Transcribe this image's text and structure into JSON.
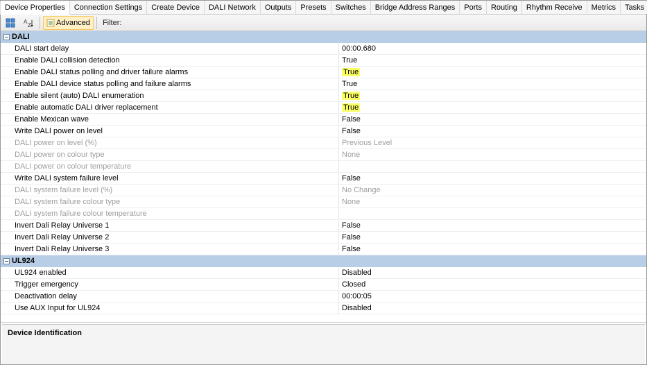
{
  "tabs": [
    "Device Properties",
    "Connection Settings",
    "Create Device",
    "DALI Network",
    "Outputs",
    "Presets",
    "Switches",
    "Bridge Address Ranges",
    "Ports",
    "Routing",
    "Rhythm Receive",
    "Metrics",
    "Tasks"
  ],
  "active_tab_index": 0,
  "toolbar": {
    "advanced_label": "Advanced",
    "filter_label": "Filter:"
  },
  "groups": [
    {
      "title": "DALI",
      "rows": [
        {
          "name": "DALI start delay",
          "value": "00:00.680",
          "disabled": false,
          "highlight": false
        },
        {
          "name": "Enable DALI collision detection",
          "value": "True",
          "disabled": false,
          "highlight": false
        },
        {
          "name": "Enable DALI status polling and driver failure alarms",
          "value": "True",
          "disabled": false,
          "highlight": true
        },
        {
          "name": "Enable DALI device status polling and failure alarms",
          "value": "True",
          "disabled": false,
          "highlight": false
        },
        {
          "name": "Enable silent (auto) DALI enumeration",
          "value": "True",
          "disabled": false,
          "highlight": true
        },
        {
          "name": "Enable automatic DALI driver replacement",
          "value": "True",
          "disabled": false,
          "highlight": true
        },
        {
          "name": "Enable Mexican wave",
          "value": "False",
          "disabled": false,
          "highlight": false
        },
        {
          "name": "Write DALI power on level",
          "value": "False",
          "disabled": false,
          "highlight": false
        },
        {
          "name": "DALI power on level (%)",
          "value": "Previous Level",
          "disabled": true,
          "highlight": false
        },
        {
          "name": "DALI power on colour type",
          "value": "None",
          "disabled": true,
          "highlight": false
        },
        {
          "name": "DALI power on colour temperature",
          "value": "",
          "disabled": true,
          "highlight": false
        },
        {
          "name": "Write DALI system failure level",
          "value": "False",
          "disabled": false,
          "highlight": false
        },
        {
          "name": "DALI system failure level (%)",
          "value": "No Change",
          "disabled": true,
          "highlight": false
        },
        {
          "name": "DALI system failure colour type",
          "value": "None",
          "disabled": true,
          "highlight": false
        },
        {
          "name": "DALI system failure colour temperature",
          "value": "",
          "disabled": true,
          "highlight": false
        },
        {
          "name": "Invert Dali Relay Universe 1",
          "value": "False",
          "disabled": false,
          "highlight": false
        },
        {
          "name": "Invert Dali Relay Universe 2",
          "value": "False",
          "disabled": false,
          "highlight": false
        },
        {
          "name": "Invert Dali Relay Universe 3",
          "value": "False",
          "disabled": false,
          "highlight": false
        }
      ]
    },
    {
      "title": "UL924",
      "rows": [
        {
          "name": "UL924 enabled",
          "value": "Disabled",
          "disabled": false,
          "highlight": false
        },
        {
          "name": "Trigger emergency",
          "value": "Closed",
          "disabled": false,
          "highlight": false
        },
        {
          "name": "Deactivation delay",
          "value": "00:00:05",
          "disabled": false,
          "highlight": false
        },
        {
          "name": "Use AUX Input for UL924",
          "value": "Disabled",
          "disabled": false,
          "highlight": false
        }
      ]
    }
  ],
  "description_title": "Device Identification"
}
